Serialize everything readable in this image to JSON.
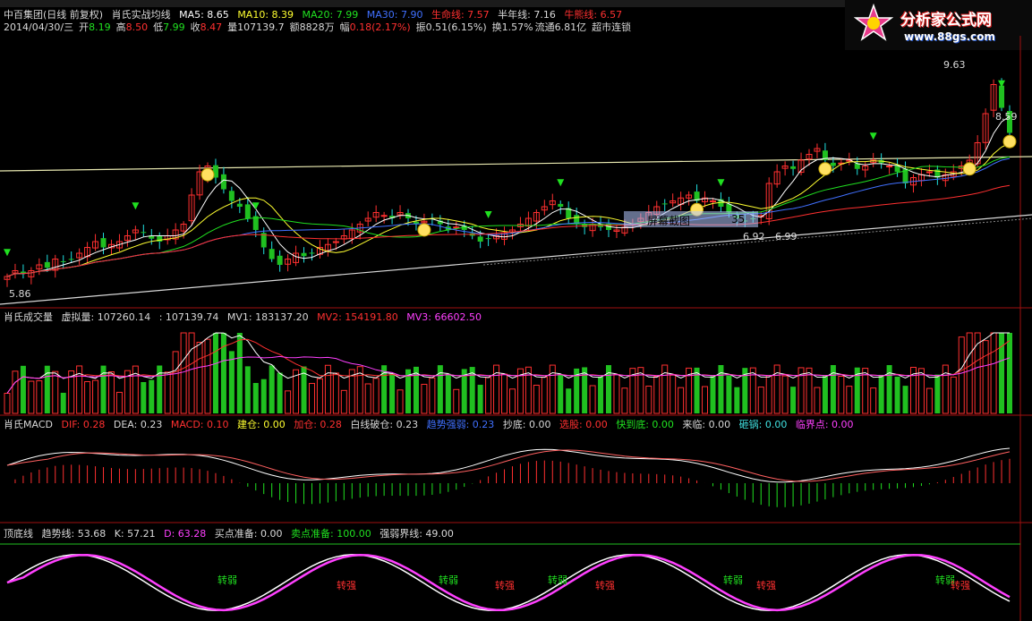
{
  "header": {
    "title": "中百集团(日线 前复权)",
    "indicator": "肖氏实战均线",
    "ma5": "MA5: 8.65",
    "ma10": "MA10: 8.39",
    "ma20": "MA20: 7.99",
    "ma30": "MA30: 7.90",
    "life_line": "生命线: 7.57",
    "half_year": "半年线: 7.16",
    "bull_bear": "牛熊线: 6.57",
    "date": "2014/04/30/三",
    "open_label": "开",
    "open_value": "8.19",
    "high_label": "高",
    "high_value": "8.50",
    "low_label": "低",
    "low_value": "7.99",
    "close_label": "收",
    "close_value": "8.47",
    "volume_label": "量",
    "volume_value": "107139.7",
    "amount": "额8828万",
    "change_label": "幅",
    "change_value": "0.18(2.17%)",
    "amplitude": "振0.51(6.15%)",
    "turnover": "换1.57%",
    "float_cap": "流通6.81亿",
    "trait": "超市连锁"
  },
  "logo": {
    "name": "分析家公式网",
    "url": "www.88gs.com"
  },
  "overlay": {
    "label": "屏幕截图",
    "number": "35"
  },
  "volume_panel": {
    "name": "肖氏成交量",
    "virtual_label": "虚拟量: 107260.14",
    "current": ": 107139.74",
    "mv1": "MV1: 183137.20",
    "mv2": "MV2: 154191.80",
    "mv3": "MV3: 66602.50"
  },
  "macd_panel": {
    "name": "肖氏MACD",
    "dif": "DIF: 0.28",
    "dea": "DEA: 0.23",
    "macd": "MACD: 0.10",
    "build": "建仓: 0.00",
    "add": "加仓: 0.28",
    "cross": "白线破仓: 0.23",
    "trend": "趋势强弱: 0.23",
    "bottom": "抄底: 0.00",
    "select": "选股: 0.00",
    "near_bottom": "快到底: 0.00",
    "coming": "来临: 0.00",
    "smash": "砸锅: 0.00",
    "critical": "临界点: 0.00"
  },
  "kd_panel": {
    "name": "顶底线",
    "trend": "趋势线: 53.68",
    "k": "K: 57.21",
    "d": "D: 63.28",
    "buy": "买点准备: 0.00",
    "sell": "卖点准备: 100.00",
    "boundary": "强弱界线: 49.00",
    "labels": [
      "转弱",
      "转强",
      "转弱",
      "转强",
      "转弱",
      "转强",
      "转弱",
      "转强",
      "转弱",
      "转强"
    ]
  },
  "price_labels": {
    "high": "9.63",
    "right": "8.59",
    "mid_low": "6.92",
    "mid_low2": "6.99",
    "low": "5.86"
  },
  "chart_data": {
    "type": "candlestick",
    "close": [
      6.0,
      6.1,
      6.05,
      6.1,
      6.2,
      6.15,
      6.3,
      6.25,
      6.3,
      6.4,
      6.5,
      6.6,
      6.5,
      6.55,
      6.6,
      6.7,
      6.8,
      6.75,
      6.65,
      6.6,
      6.7,
      6.8,
      6.9,
      7.4,
      7.8,
      7.9,
      7.7,
      7.5,
      7.3,
      7.2,
      7.0,
      6.8,
      6.5,
      6.3,
      6.2,
      6.3,
      6.4,
      6.35,
      6.4,
      6.5,
      6.55,
      6.6,
      6.7,
      6.8,
      6.9,
      7.0,
      7.1,
      7.05,
      7.0,
      7.1,
      7.0,
      6.9,
      6.95,
      7.0,
      6.9,
      6.8,
      6.85,
      6.8,
      6.7,
      6.6,
      6.65,
      6.7,
      6.75,
      6.8,
      6.9,
      7.0,
      7.1,
      7.2,
      7.3,
      7.2,
      7.0,
      6.9,
      6.85,
      6.9,
      6.85,
      6.8,
      6.8,
      6.85,
      6.9,
      7.0,
      7.1,
      7.2,
      7.25,
      7.3,
      7.35,
      7.4,
      7.3,
      7.35,
      7.3,
      7.2,
      7.1,
      7.0,
      6.95,
      7.0,
      7.05,
      7.6,
      7.8,
      7.9,
      7.85,
      8.0,
      8.1,
      8.2,
      8.0,
      7.9,
      7.95,
      8.0,
      7.85,
      7.9,
      8.0,
      7.95,
      7.9,
      7.8,
      7.6,
      7.7,
      7.75,
      7.8,
      7.7,
      7.75,
      7.8,
      7.9,
      8.0,
      8.3,
      8.8,
      9.3,
      8.9,
      8.47
    ],
    "series": [
      {
        "name": "MA5",
        "color": "#ffffff"
      },
      {
        "name": "MA10",
        "color": "#ffff30"
      },
      {
        "name": "MA20",
        "color": "#20e020"
      },
      {
        "name": "MA30",
        "color": "#4070ff"
      },
      {
        "name": "生命线",
        "color": "#ff3030"
      }
    ]
  }
}
